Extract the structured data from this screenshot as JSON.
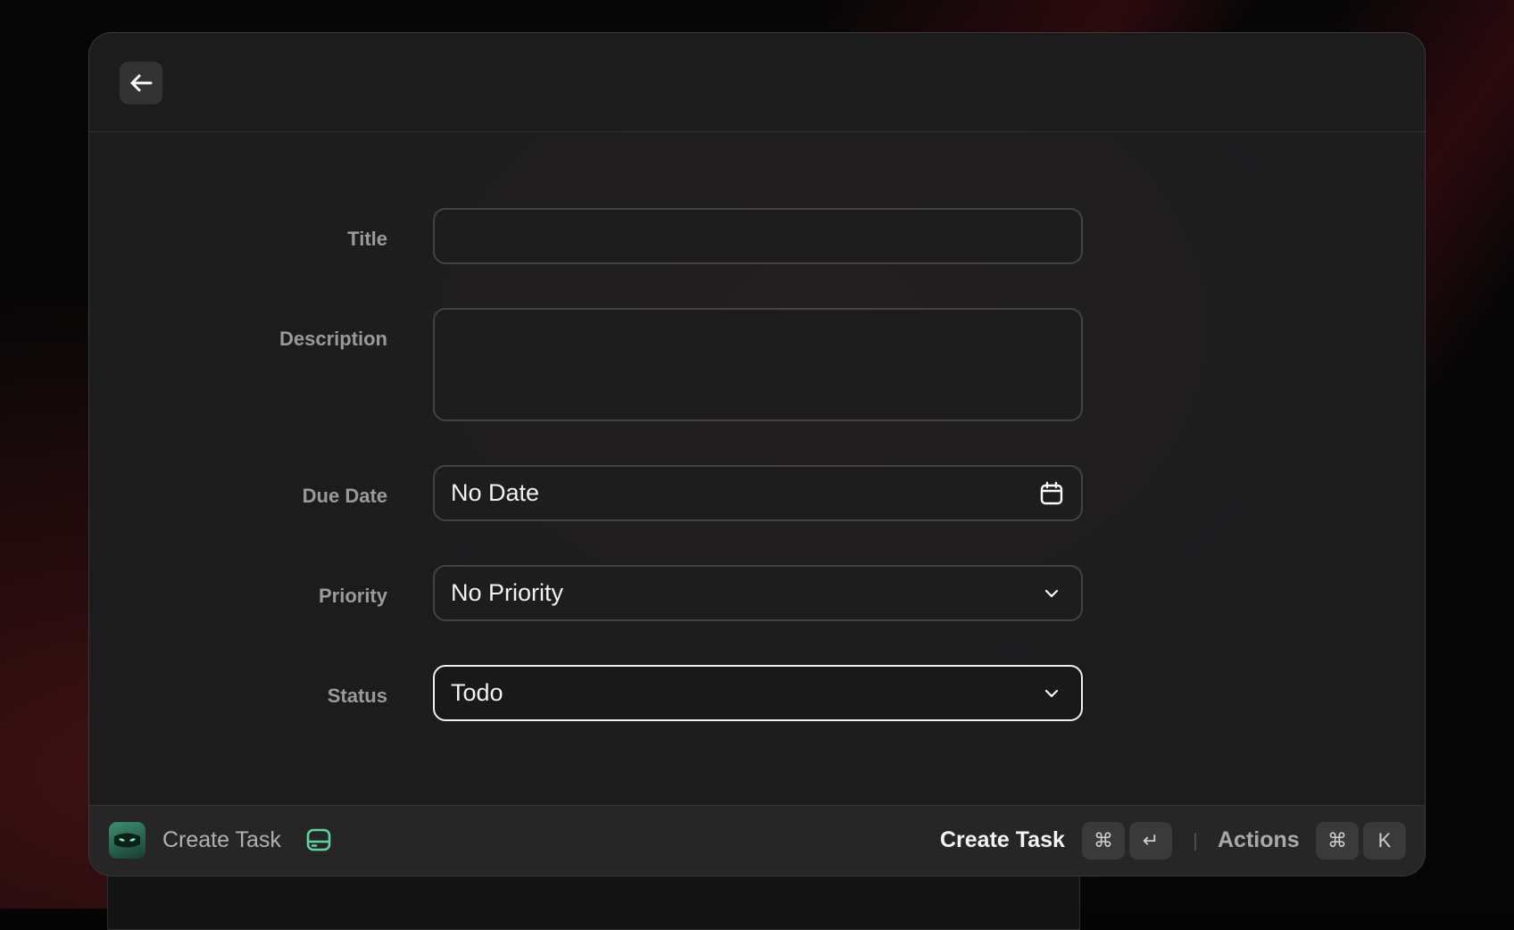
{
  "form": {
    "title_label": "Title",
    "title_value": "",
    "description_label": "Description",
    "description_value": "",
    "due_date_label": "Due Date",
    "due_date_value": "No Date",
    "priority_label": "Priority",
    "priority_value": "No Priority",
    "status_label": "Status",
    "status_value": "Todo"
  },
  "footer": {
    "title": "Create Task",
    "primary_action": "Create Task",
    "primary_shortcut": [
      "⌘",
      "↵"
    ],
    "secondary_action": "Actions",
    "secondary_shortcut": [
      "⌘",
      "K"
    ]
  },
  "icons": {
    "back": "arrow-left-icon",
    "calendar": "calendar-icon",
    "chevron": "chevron-down-icon",
    "drive": "hard-drive-icon",
    "app": "ninja-mask-icon"
  },
  "colors": {
    "accent": "#5fd3a0",
    "focus_border": "#f0f0f0"
  }
}
